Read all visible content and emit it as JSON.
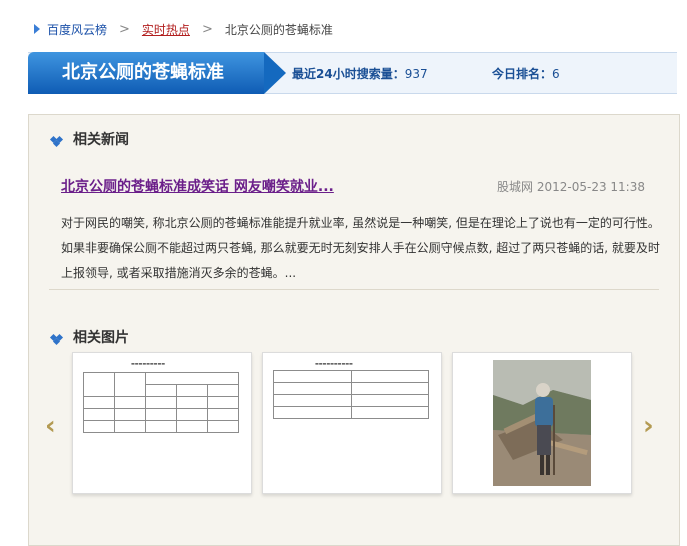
{
  "breadcrumb": {
    "items": [
      "百度风云榜",
      "实时热点",
      "北京公厕的苍蝇标准"
    ],
    "separator": ">"
  },
  "header": {
    "title": "北京公厕的苍蝇标准",
    "search_label": "最近24小时搜索量：",
    "search_value": "937",
    "rank_label": "今日排名：",
    "rank_value": "6"
  },
  "news": {
    "section_title": "相关新闻",
    "headline": "北京公厕的苍蝇标准成笑话 网友嘲笑就业...",
    "source": "股城网",
    "datetime": "2012-05-23 11:38",
    "body": "对于网民的嘲笑, 称北京公厕的苍蝇标准能提升就业率, 虽然说是一种嘲笑, 但是在理论上了说也有一定的可行性。如果非要确保公厕不能超过两只苍蝇, 那么就要无时无刻安排人手在公厕守候点数, 超过了两只苍蝇的话, 就要及时上报领导, 或者采取措施消灭多余的苍蝇。..."
  },
  "pictures": {
    "section_title": "相关图片",
    "prev_glyph": "‹",
    "next_glyph": "›"
  },
  "colors": {
    "accent_blue": "#1469bf",
    "visited_link": "#6b1f8a",
    "current_crumb": "#b21f1f",
    "panel_bg": "#f6f4ee",
    "arrow_gold": "#b39a52"
  }
}
